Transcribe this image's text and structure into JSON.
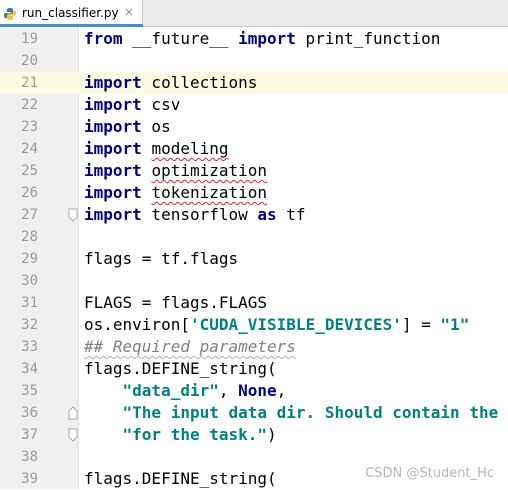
{
  "tab": {
    "label": "run_classifier.py",
    "close": "×",
    "icon": "python-file-icon"
  },
  "lines": {
    "l19": {
      "num": "19",
      "t1": "from",
      "t2": " __future__ ",
      "t3": "import",
      "t4": " print_function"
    },
    "l20": {
      "num": "20"
    },
    "l21": {
      "num": "21",
      "t1": "import",
      "t2": " collections"
    },
    "l22": {
      "num": "22",
      "t1": "import",
      "t2": " csv"
    },
    "l23": {
      "num": "23",
      "t1": "import",
      "t2": " os"
    },
    "l24": {
      "num": "24",
      "t1": "import",
      "t2": " ",
      "t3": "modeling"
    },
    "l25": {
      "num": "25",
      "t1": "import",
      "t2": " ",
      "t3": "optimization"
    },
    "l26": {
      "num": "26",
      "t1": "import",
      "t2": " ",
      "t3": "tokenization"
    },
    "l27": {
      "num": "27",
      "t1": "import",
      "t2": " tensorflow ",
      "t3": "as",
      "t4": " tf"
    },
    "l28": {
      "num": "28"
    },
    "l29": {
      "num": "29",
      "t1": "flags = tf.flags"
    },
    "l30": {
      "num": "30"
    },
    "l31": {
      "num": "31",
      "t1": "FLAGS = flags.FLAGS"
    },
    "l32": {
      "num": "32",
      "t1": "os.environ[",
      "t2": "'CUDA_VISIBLE_DEVICES'",
      "t3": "] = ",
      "t4": "\"1\""
    },
    "l33": {
      "num": "33",
      "t1": "## Required parameters"
    },
    "l34": {
      "num": "34",
      "t1": "flags.DEFINE_string("
    },
    "l35": {
      "num": "35",
      "t1": "    ",
      "t2": "\"data_dir\"",
      "t3": ", ",
      "t4": "None",
      "t5": ","
    },
    "l36": {
      "num": "36",
      "t1": "    ",
      "t2": "\"The input data dir. Should contain the"
    },
    "l37": {
      "num": "37",
      "t1": "    ",
      "t2": "\"for the task.\"",
      "t3": ")"
    },
    "l38": {
      "num": "38"
    },
    "l39": {
      "num": "39",
      "t1": "flags.DEFINE_string("
    }
  },
  "watermark": "CSDN @Student_Hc",
  "colors": {
    "keyword": "#000080",
    "string": "#008080",
    "comment": "#808080",
    "current_line": "#fdfbe2"
  }
}
